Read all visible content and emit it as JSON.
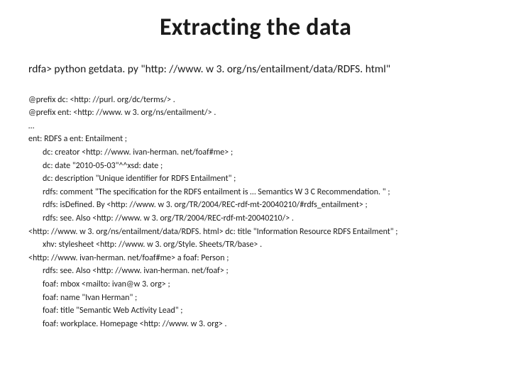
{
  "title": "Extracting the data",
  "command": "rdfa> python getdata. py \"http: //www. w 3. org/ns/entailment/data/RDFS. html\"",
  "code": {
    "l1": "@prefix dc: <http: //purl. org/dc/terms/> .",
    "l2": "@prefix ent: <http: //www. w 3. org/ns/entailment/> .",
    "l3": "…",
    "l4": "ent: RDFS a ent: Entailment ;",
    "l5": "dc: creator <http: //www. ivan-herman. net/foaf#me> ;",
    "l6": "dc: date \"2010-05-03\"^^xsd: date ;",
    "l7": "dc: description \"Unique identifier for RDFS Entailment\" ;",
    "l8": "rdfs: comment \"The specification for the RDFS entailment is … Semantics W 3 C Recommendation. \" ;",
    "l9": "rdfs: isDefined. By <http: //www. w 3. org/TR/2004/REC-rdf-mt-20040210/#rdfs_entailment> ;",
    "l10": "rdfs: see. Also <http: //www. w 3. org/TR/2004/REC-rdf-mt-20040210/> .",
    "l11": "<http: //www. w 3. org/ns/entailment/data/RDFS. html> dc: title \"Information Resource RDFS Entailment\" ;",
    "l12": "xhv: stylesheet <http: //www. w 3. org/Style. Sheets/TR/base> .",
    "l13": "<http: //www. ivan-herman. net/foaf#me> a foaf: Person ;",
    "l14": "rdfs: see. Also <http: //www. ivan-herman. net/foaf> ;",
    "l15": "foaf: mbox <mailto: ivan@w 3. org> ;",
    "l16": "foaf: name \"Ivan Herman\" ;",
    "l17": "foaf: title \"Semantic Web Activity Lead\" ;",
    "l18": "foaf: workplace. Homepage <http: //www. w 3. org> ."
  }
}
